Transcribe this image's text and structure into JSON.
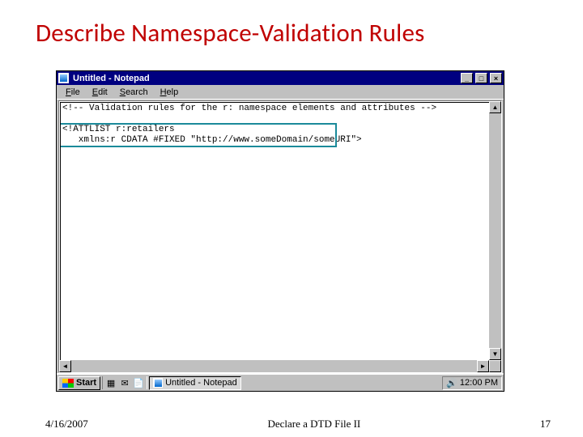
{
  "slide": {
    "title": "Describe Namespace-Validation Rules",
    "date": "4/16/2007",
    "footer_center": "Declare a DTD File II",
    "page_number": "17"
  },
  "window": {
    "title": "Untitled - Notepad",
    "menu": {
      "file": "File",
      "edit": "Edit",
      "search": "Search",
      "help": "Help"
    },
    "controls": {
      "min": "_",
      "max": "□",
      "close": "×"
    }
  },
  "editor": {
    "line1": "<!-- Validation rules for the r: namespace elements and attributes -->",
    "line2": "",
    "line3": "<!ATTLIST r:retailers",
    "line4": "   xmlns:r CDATA #FIXED \"http://www.someDomain/someURI\">"
  },
  "taskbar": {
    "start": "Start",
    "task_active": "Untitled - Notepad",
    "clock": "12:00 PM"
  }
}
